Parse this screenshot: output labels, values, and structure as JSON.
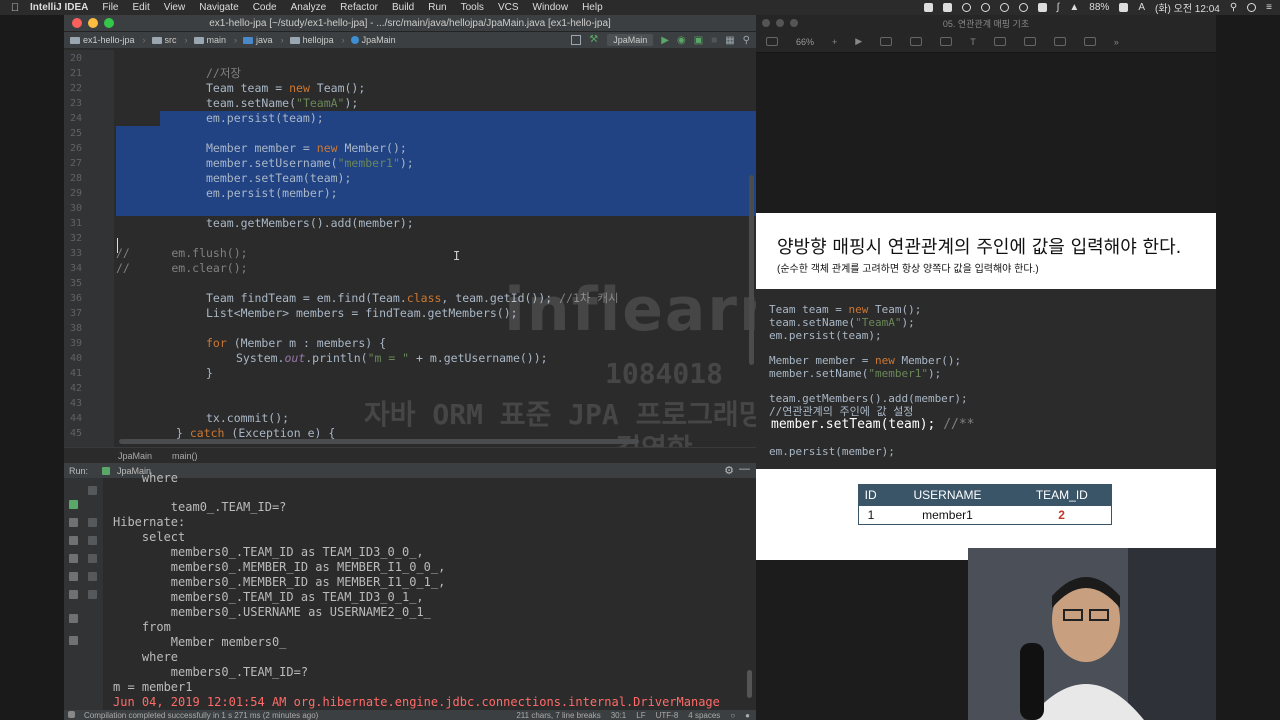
{
  "menubar": {
    "app_name": "IntelliJ IDEA",
    "items": [
      "File",
      "Edit",
      "View",
      "Navigate",
      "Code",
      "Analyze",
      "Refactor",
      "Build",
      "Run",
      "Tools",
      "VCS",
      "Window",
      "Help"
    ],
    "battery": "88%",
    "clock": "(화) 오전 12:04"
  },
  "ide": {
    "title": "ex1-hello-jpa [~/study/ex1-hello-jpa] - .../src/main/java/hellojpa/JpaMain.java [ex1-hello-jpa]",
    "breadcrumbs": [
      "ex1-hello-jpa",
      "src",
      "main",
      "java",
      "hellojpa",
      "JpaMain"
    ],
    "run_config": "JpaMain",
    "editor_crumbs": [
      "JpaMain",
      "main()"
    ],
    "code_lines": [
      {
        "n": "20",
        "text": ""
      },
      {
        "n": "21",
        "text": "//저장"
      },
      {
        "n": "22",
        "text": "Team team = new Team();"
      },
      {
        "n": "23",
        "text": "team.setName(\"TeamA\");"
      },
      {
        "n": "24",
        "text": "em.persist(team);"
      },
      {
        "n": "25",
        "text": ""
      },
      {
        "n": "26",
        "text": "Member member = new Member();"
      },
      {
        "n": "27",
        "text": "member.setUsername(\"member1\");"
      },
      {
        "n": "28",
        "text": "member.setTeam(team);"
      },
      {
        "n": "29",
        "text": "em.persist(member);"
      },
      {
        "n": "30",
        "text": ""
      },
      {
        "n": "31",
        "text": "team.getMembers().add(member);"
      },
      {
        "n": "32",
        "text": ""
      },
      {
        "n": "33",
        "text": "//      em.flush();"
      },
      {
        "n": "34",
        "text": "//      em.clear();"
      },
      {
        "n": "35",
        "text": ""
      },
      {
        "n": "36",
        "text": "Team findTeam = em.find(Team.class, team.getId()); //1차 캐시"
      },
      {
        "n": "37",
        "text": "List<Member> members = findTeam.getMembers();"
      },
      {
        "n": "38",
        "text": ""
      },
      {
        "n": "39",
        "text": "for (Member m : members) {"
      },
      {
        "n": "40",
        "text": "System.out.println(\"m = \" + m.getUsername());"
      },
      {
        "n": "41",
        "text": "}"
      },
      {
        "n": "42",
        "text": ""
      },
      {
        "n": "43",
        "text": ""
      },
      {
        "n": "44",
        "text": "tx.commit();"
      },
      {
        "n": "45",
        "text": "} catch (Exception e) {"
      }
    ],
    "watermark": {
      "logo": "inflearn",
      "number": "1084018",
      "course": "자바 ORM 표준 JPA 프로그래밍 - 기본편",
      "name": "김영한"
    },
    "run_panel": {
      "label": "Run:",
      "tab": "JpaMain",
      "lines": [
        "    where",
        "        team0_.TEAM_ID=?",
        "Hibernate: ",
        "    select",
        "        members0_.TEAM_ID as TEAM_ID3_0_0_,",
        "        members0_.MEMBER_ID as MEMBER_I1_0_0_,",
        "        members0_.MEMBER_ID as MEMBER_I1_0_1_,",
        "        members0_.TEAM_ID as TEAM_ID3_0_1_,",
        "        members0_.USERNAME as USERNAME2_0_1_ ",
        "    from",
        "        Member members0_ ",
        "    where",
        "        members0_.TEAM_ID=?",
        "m = member1",
        "Jun 04, 2019 12:01:54 AM org.hibernate.engine.jdbc.connections.internal.DriverManage"
      ]
    },
    "status": {
      "message": "Compilation completed successfully in 1 s 271 ms (2 minutes ago)",
      "chars": "211 chars, 7 line breaks",
      "position": "30:1",
      "line_sep": "LF",
      "encoding": "UTF-8",
      "indent": "4 spaces"
    }
  },
  "keynote": {
    "title": "05. 연관관계 매핑 기초",
    "zoom": "66%",
    "slide": {
      "title": "양방향 매핑시 연관관계의 주인에 값을 입력해야 한다.",
      "subtitle": "(순수한 객체 관계를 고려하면 항상 양쪽다 값을 입력해야 한다.)",
      "code_lines": [
        "Team team = new Team();",
        "team.setName(\"TeamA\");",
        "em.persist(team);",
        "",
        "Member member = new Member();",
        "member.setName(\"member1\");",
        "",
        "team.getMembers().add(member);",
        "//연관관계의 주인에 값 설정",
        "member.setTeam(team); //**",
        "",
        "em.persist(member);"
      ],
      "table": {
        "headers": [
          "ID",
          "USERNAME",
          "TEAM_ID"
        ],
        "rows": [
          [
            "1",
            "member1",
            "2"
          ]
        ]
      }
    }
  }
}
